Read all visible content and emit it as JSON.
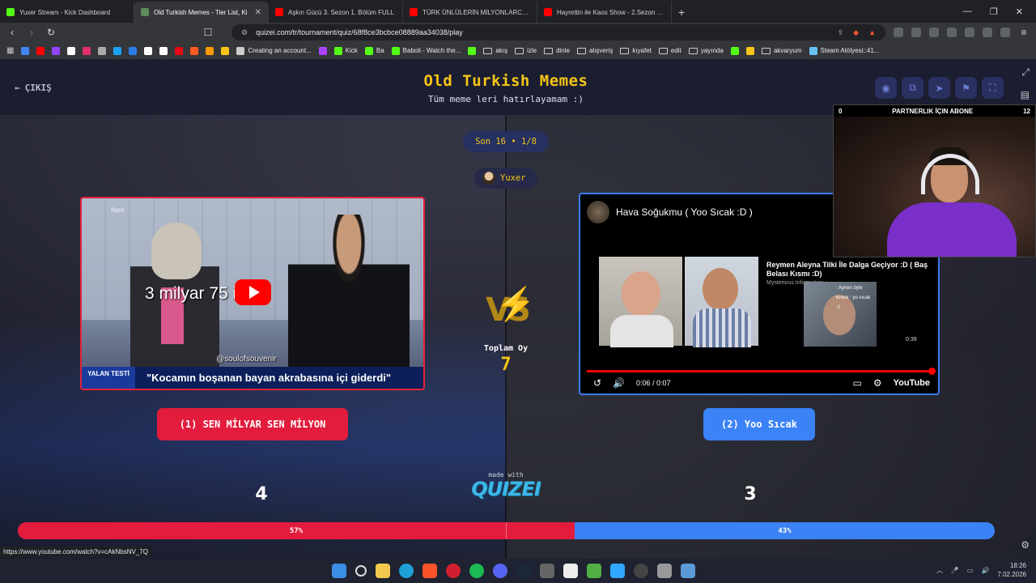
{
  "browser": {
    "tabs": [
      {
        "title": "Yuxer Stream - Kick Dashboard",
        "icon": "kick-icon",
        "color": "#53fc18",
        "active": false
      },
      {
        "title": "Old Turkish Memes - Tier List, Ki",
        "icon": "quizei-icon",
        "color": "#5b8c5a",
        "active": true
      },
      {
        "title": "Aşkın Gücü 3. Sezon 1. Bölüm FULL",
        "icon": "youtube-icon",
        "color": "#ff0000",
        "active": false
      },
      {
        "title": "TÜRK ÜNLÜLERİN MİLYONLARCA DO",
        "icon": "youtube-icon",
        "color": "#ff0000",
        "active": false
      },
      {
        "title": "Hayrettin ile Kaos Show - 2.Sezon 1.B",
        "icon": "youtube-icon",
        "color": "#ff0000",
        "active": false
      }
    ],
    "url": "quizei.com/tr/tournament/quiz/68f8ce3bcbce08889aa34038/play",
    "bookmarks": [
      {
        "label": "",
        "type": "icon",
        "color": "#4285f4"
      },
      {
        "label": "",
        "type": "icon",
        "color": "#ff0000"
      },
      {
        "label": "",
        "type": "icon",
        "color": "#9146ff"
      },
      {
        "label": "",
        "type": "icon",
        "color": "#ffffff"
      },
      {
        "label": "",
        "type": "icon",
        "color": "#e1306c"
      },
      {
        "label": "",
        "type": "icon",
        "color": "#aaaaaa"
      },
      {
        "label": "",
        "type": "icon",
        "color": "#1da1f2"
      },
      {
        "label": "",
        "type": "icon",
        "color": "#2b7de9"
      },
      {
        "label": "",
        "type": "icon",
        "color": "#ffffff"
      },
      {
        "label": "",
        "type": "icon",
        "color": "#ffffff"
      },
      {
        "label": "",
        "type": "icon",
        "color": "#e50914"
      },
      {
        "label": "",
        "type": "icon",
        "color": "#ff5a1f"
      },
      {
        "label": "",
        "type": "icon",
        "color": "#ff9900"
      },
      {
        "label": "",
        "type": "icon",
        "color": "#f5c518"
      },
      {
        "label": "Creating an account...",
        "type": "link",
        "color": "#cccccc"
      },
      {
        "label": "",
        "type": "icon",
        "color": "#aa44ff"
      },
      {
        "label": "Kick",
        "type": "link",
        "color": "#53fc18"
      },
      {
        "label": "Ba",
        "type": "link",
        "color": "#53fc18"
      },
      {
        "label": "Baboli - Watch the...",
        "type": "link",
        "color": "#53fc18"
      },
      {
        "label": "",
        "type": "icon",
        "color": "#53fc18"
      },
      {
        "label": "akış",
        "type": "folder"
      },
      {
        "label": "izle",
        "type": "folder"
      },
      {
        "label": "dinle",
        "type": "folder"
      },
      {
        "label": "alışveriş",
        "type": "folder"
      },
      {
        "label": "kıyafet",
        "type": "folder"
      },
      {
        "label": "edit",
        "type": "folder"
      },
      {
        "label": "yayında",
        "type": "folder"
      },
      {
        "label": "",
        "type": "icon",
        "color": "#53fc18"
      },
      {
        "label": "",
        "type": "icon",
        "color": "#f5c518"
      },
      {
        "label": "akvaryum",
        "type": "folder"
      },
      {
        "label": "Steam Atölyesi::41...",
        "type": "link",
        "color": "#66c0f4"
      }
    ],
    "status_url": "https://www.youtube.com/watch?v=cAkNbsNV_7Q"
  },
  "page": {
    "exit_label": "ÇIKIŞ",
    "title": "Old Turkish Memes",
    "subtitle": "Tüm meme leri hatırlayamam :)",
    "round": "Son 16 • 1/8",
    "user": "Yuxer",
    "total_label": "Toplam Oy",
    "total_votes": "7",
    "made_with": "made with",
    "brand": "QUIZEI",
    "accent": "#f5c518"
  },
  "left": {
    "overlay_text": "3 milyar 75   ilyon",
    "handle": "@soulofsouvenir",
    "lower_tag": "YALAN TESTİ",
    "lower_text": "\"Kocamın boşanan bayan akrabasına içi giderdi\"",
    "button_label": "(1) SEN MİLYAR SEN MİLYON",
    "votes": "4",
    "percent": "57%",
    "share": 0.57,
    "color": "#e31c3d"
  },
  "right": {
    "video_title": "Hava Soğukmu ( Yoo Sıcak :D )",
    "related_title": "Reymen Aleyna Tilki İle Dalga Geçiyor :D ( Baş Belası Kısmı :D)",
    "related_channel": "Mysterious Information •",
    "related_duration": "0:39",
    "chat": [
      ": Aynen öyle",
      "Kresk : yo sıcak",
      ":2"
    ],
    "time": "0:06 / 0:07",
    "yt_logo": "YouTube",
    "button_label": "(2) Yoo Sıcak",
    "votes": "3",
    "percent": "43%",
    "share": 0.43,
    "color": "#3b82f6"
  },
  "webcam": {
    "left_count": "0",
    "banner": "PARTNERLIK İÇIN ABONE",
    "right_count": "12"
  },
  "taskbar": {
    "time": "18:26",
    "date": "7.02.2026"
  }
}
